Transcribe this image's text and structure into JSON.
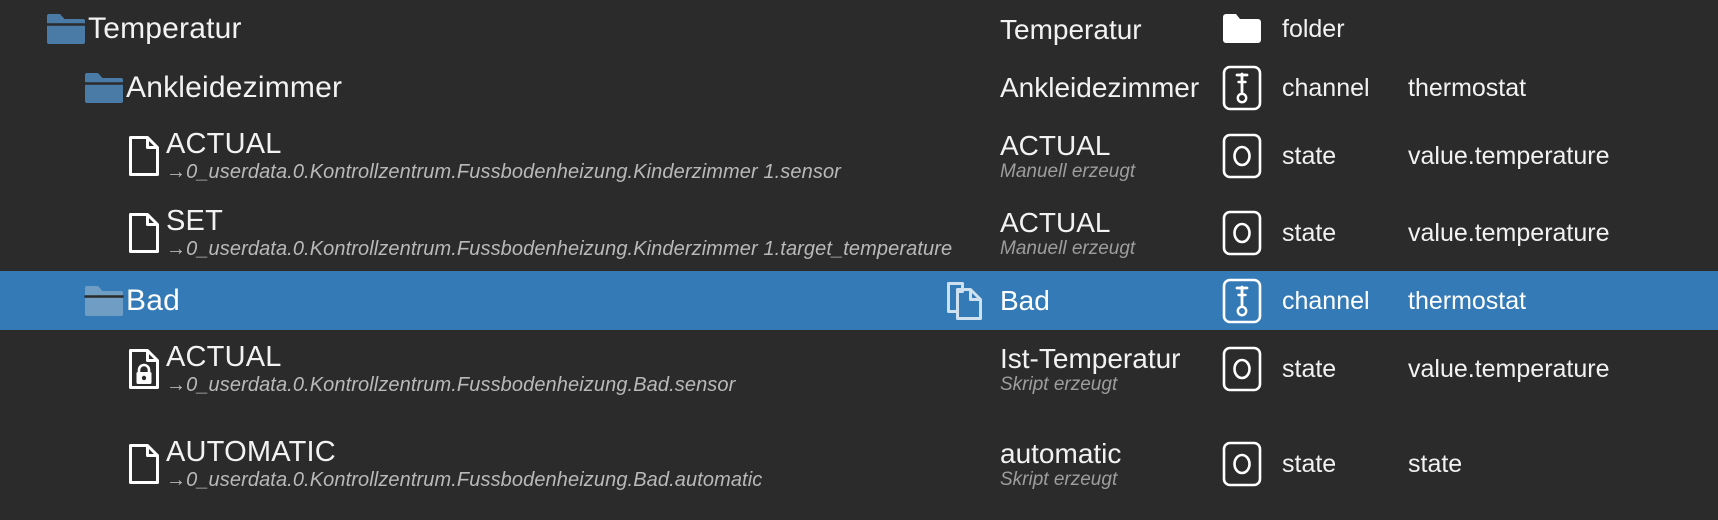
{
  "theme": {
    "background": "#2b2b2b",
    "selected_background": "#337ab7",
    "text": "#f2f2f2",
    "muted_text": "#b9b9b9",
    "folder_icon_color": "#4a7ba7"
  },
  "tree": {
    "rows": [
      {
        "id": "temperatur",
        "icon": "folder-open-icon",
        "indent": 44,
        "title": "Temperatur",
        "path": "",
        "selected": false,
        "copy_icon": "",
        "detail": {
          "name": "Temperatur",
          "name_sub": "",
          "type_icon": "folder-icon",
          "type": "folder",
          "role": ""
        }
      },
      {
        "id": "ankleidezimmer",
        "icon": "folder-open-icon",
        "indent": 82,
        "title": "Ankleidezimmer",
        "path": "",
        "selected": false,
        "copy_icon": "",
        "detail": {
          "name": "Ankleidezimmer",
          "name_sub": "",
          "type_icon": "thermostat-channel-icon",
          "type": "channel",
          "role": "thermostat"
        }
      },
      {
        "id": "ankleidezimmer-actual",
        "icon": "file-icon",
        "indent": 122,
        "title": "ACTUAL",
        "path": "→0_userdata.0.Kontrollzentrum.Fussbodenheizung.Kinderzimmer 1.sensor",
        "selected": false,
        "copy_icon": "",
        "detail": {
          "name": "ACTUAL",
          "name_sub": "Manuell erzeugt",
          "type_icon": "state-icon",
          "type": "state",
          "role": "value.temperature"
        }
      },
      {
        "id": "ankleidezimmer-set",
        "icon": "file-icon",
        "indent": 122,
        "title": "SET",
        "path": "→0_userdata.0.Kontrollzentrum.Fussbodenheizung.Kinderzimmer 1.target_temperature",
        "selected": false,
        "copy_icon": "",
        "detail": {
          "name": "ACTUAL",
          "name_sub": "Manuell erzeugt",
          "type_icon": "state-icon",
          "type": "state",
          "role": "value.temperature"
        }
      },
      {
        "id": "bad",
        "icon": "folder-open-icon",
        "indent": 82,
        "title": "Bad",
        "path": "",
        "selected": true,
        "copy_icon": "copy-icon",
        "detail": {
          "name": "Bad",
          "name_sub": "",
          "type_icon": "thermostat-channel-icon",
          "type": "channel",
          "role": "thermostat"
        }
      },
      {
        "id": "bad-actual",
        "icon": "file-locked-icon",
        "indent": 122,
        "title": "ACTUAL",
        "path": "→0_userdata.0.Kontrollzentrum.Fussbodenheizung.Bad.sensor",
        "selected": false,
        "copy_icon": "",
        "detail": {
          "name": "Ist-Temperatur",
          "name_sub": "Skript erzeugt",
          "type_icon": "state-icon",
          "type": "state",
          "role": "value.temperature"
        }
      },
      {
        "id": "bad-automatic",
        "icon": "file-icon",
        "indent": 122,
        "title": "AUTOMATIC",
        "path": "→0_userdata.0.Kontrollzentrum.Fussbodenheizung.Bad.automatic",
        "selected": false,
        "copy_icon": "",
        "detail": {
          "name": "automatic",
          "name_sub": "Skript erzeugt",
          "type_icon": "state-icon",
          "type": "state",
          "role": "state"
        }
      }
    ]
  }
}
